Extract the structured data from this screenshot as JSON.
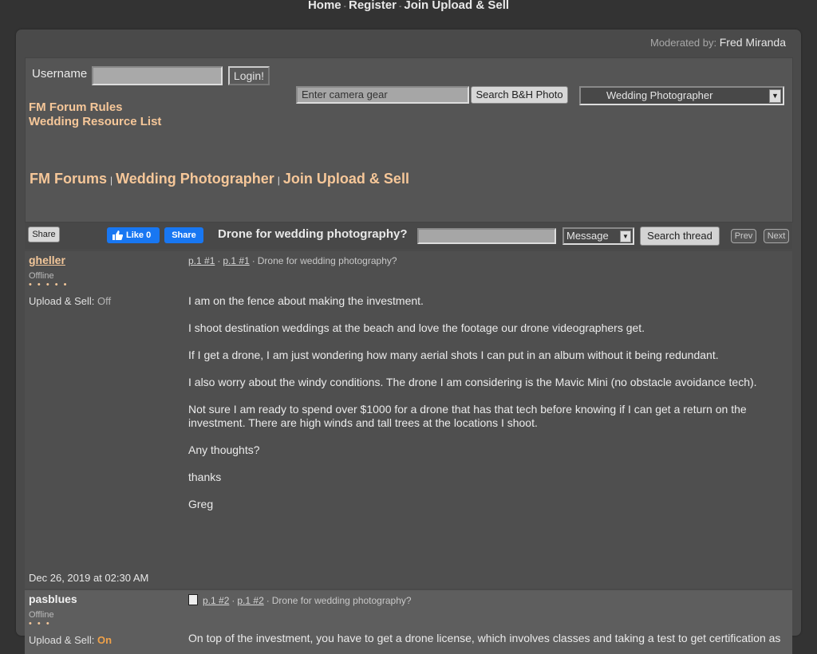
{
  "top_nav": {
    "home": "Home",
    "register": "Register",
    "join": "Join Upload & Sell",
    "sep": "-"
  },
  "moderated": {
    "label": "Moderated by:",
    "name": "Fred Miranda"
  },
  "login": {
    "username_label": "Username",
    "username_value": "",
    "login_button": "Login!"
  },
  "links": {
    "forum_rules": "FM Forum Rules",
    "wedding_list": "Wedding Resource List"
  },
  "gear_search": {
    "placeholder": "Enter camera gear",
    "button": "Search B&H Photo"
  },
  "forum_select": {
    "selected": "Wedding Photographer"
  },
  "breadcrumbs": {
    "forums": "FM Forums",
    "wedding": "Wedding Photographer",
    "join": "Join Upload & Sell",
    "pipe": "|"
  },
  "toolbar": {
    "share": "Share",
    "fb_like": "Like 0",
    "fb_share": "Share",
    "thread_title": "Drone for wedding photography?",
    "search_value": "",
    "msg_select": "Message",
    "search_thread": "Search thread",
    "prev": "Prev",
    "next": "Next"
  },
  "post1": {
    "author": "gheller",
    "status": "Offline",
    "stars": "• • • • •",
    "us_label": "Upload & Sell",
    "us_colon": ":",
    "us_value": "Off",
    "link1": "p.1 #1",
    "link2": "p.1 #1",
    "subject": "Drone for wedding photography?",
    "paragraphs": [
      "I am on the fence about making the investment.",
      "I shoot destination weddings at the beach and love the footage our drone videographers get.",
      "If I get a drone, I am just wondering how many aerial shots I can put in an album without it being redundant.",
      "I also worry about the windy conditions. The drone I am considering is the Mavic Mini (no obstacle avoidance tech).",
      "Not sure I am ready to spend over $1000 for a drone that has that tech before knowing if I can get a return on the investment. There are high winds and tall trees at the locations I shoot.",
      "Any thoughts?",
      "thanks",
      "Greg"
    ],
    "date": "Dec 26, 2019 at 02:30 AM"
  },
  "post2": {
    "author": "pasblues",
    "status": "Offline",
    "stars": "• • •",
    "us_label": "Upload & Sell",
    "us_colon": ":",
    "us_value": "On",
    "link1": "p.1 #2",
    "link2": "p.1 #2",
    "subject": "Drone for wedding photography?",
    "body": "On top of the investment, you have to get a drone license, which involves classes and taking a test to get certification as"
  }
}
